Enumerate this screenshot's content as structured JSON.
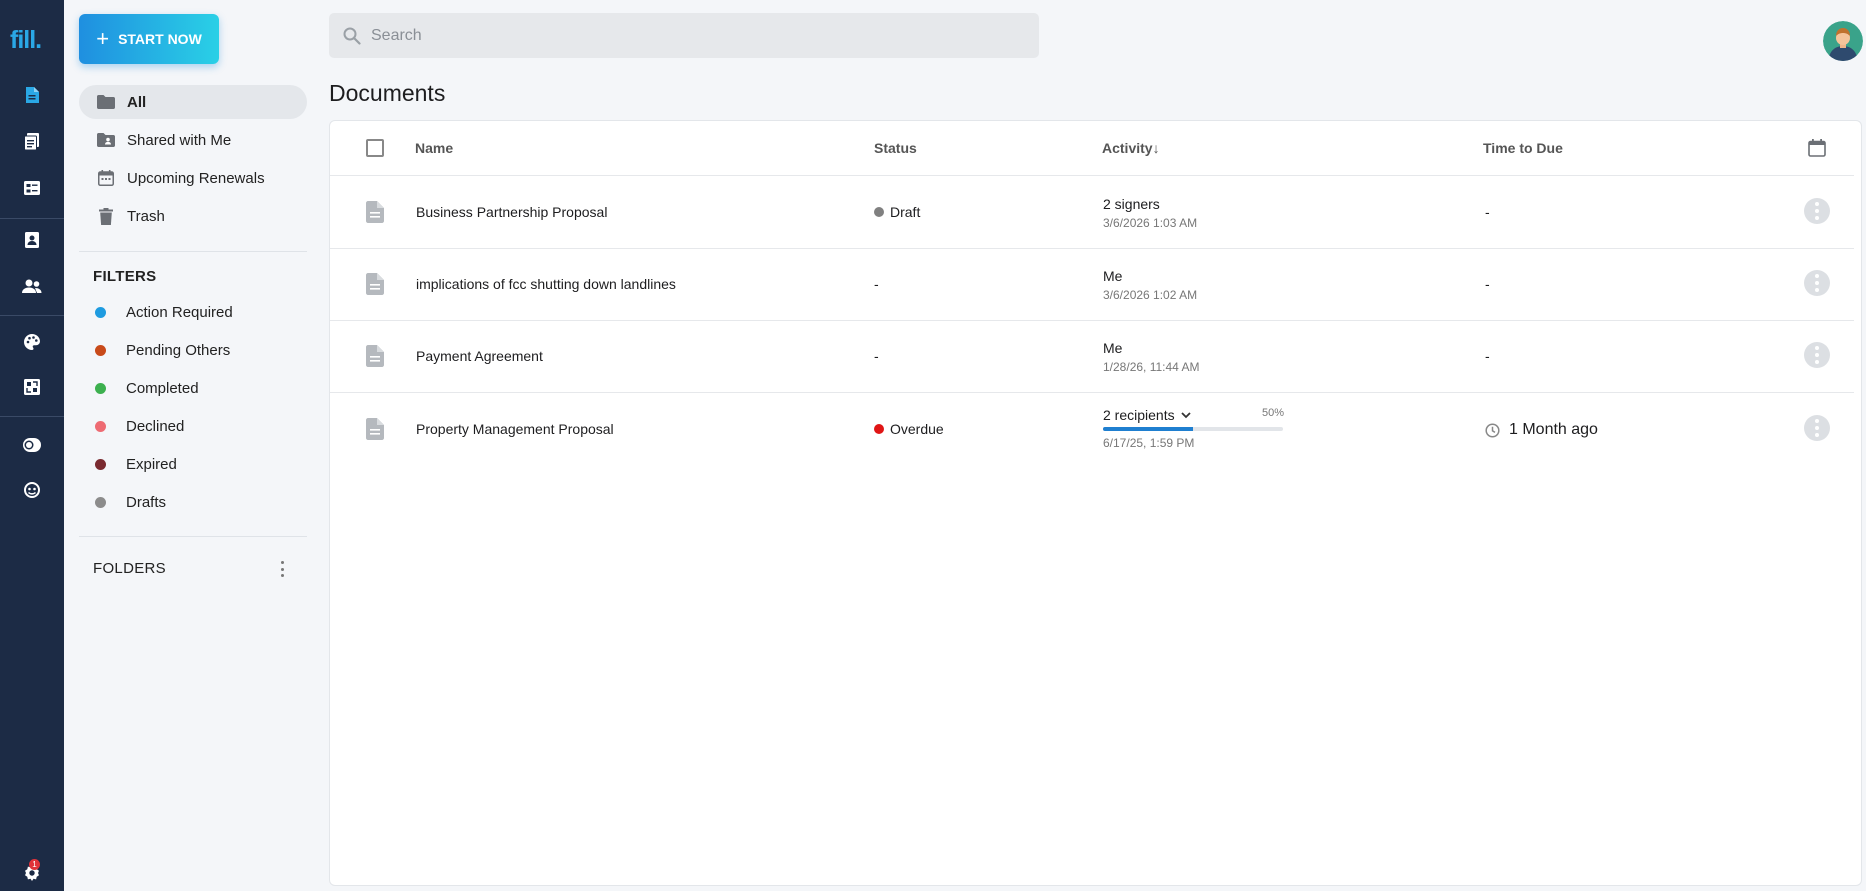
{
  "app": {
    "logo_text": "fill."
  },
  "rail": {
    "icons": [
      "documents-icon",
      "templates-icon",
      "forms-icon",
      "contacts-icon",
      "team-icon",
      "branding-icon",
      "integrations-icon",
      "theme-icon",
      "support-icon",
      "settings-icon"
    ],
    "settings_badge": "1"
  },
  "start_button": {
    "label": "START NOW"
  },
  "nav": {
    "items": [
      {
        "label": "All",
        "icon": "folder-icon"
      },
      {
        "label": "Shared with Me",
        "icon": "shared-folder-icon"
      },
      {
        "label": "Upcoming Renewals",
        "icon": "calendar-icon"
      },
      {
        "label": "Trash",
        "icon": "trash-icon"
      }
    ],
    "active_index": 0
  },
  "filters": {
    "title": "FILTERS",
    "items": [
      {
        "label": "Action Required",
        "color": "#1e9be0"
      },
      {
        "label": "Pending Others",
        "color": "#c84a1a"
      },
      {
        "label": "Completed",
        "color": "#3cb04f"
      },
      {
        "label": "Declined",
        "color": "#ee6b73"
      },
      {
        "label": "Expired",
        "color": "#7a2a30"
      },
      {
        "label": "Drafts",
        "color": "#8c8c8c"
      }
    ]
  },
  "folders": {
    "title": "FOLDERS"
  },
  "search": {
    "placeholder": "Search"
  },
  "page": {
    "title": "Documents"
  },
  "table": {
    "columns": {
      "name": "Name",
      "status": "Status",
      "activity": "Activity",
      "activity_sort": "↓",
      "time_to_due": "Time to Due"
    },
    "rows": [
      {
        "name": "Business Partnership Proposal",
        "status": "Draft",
        "status_color": "#808080",
        "activity_main": "2 signers",
        "activity_sub": "3/6/2026 1:03 AM",
        "due": "-"
      },
      {
        "name": "implications of fcc shutting down landlines",
        "status": "-",
        "activity_main": "Me",
        "activity_sub": "3/6/2026 1:02 AM",
        "due": "-"
      },
      {
        "name": "Payment Agreement",
        "status": "-",
        "activity_main": "Me",
        "activity_sub": "1/28/26, 11:44 AM",
        "due": "-"
      },
      {
        "name": "Property Management Proposal",
        "status": "Overdue",
        "status_color": "#e01515",
        "activity_main": "2 recipients",
        "activity_sub": "6/17/25, 1:59 PM",
        "progress_label": "50%",
        "progress": 0.5,
        "due": "1 Month ago"
      }
    ]
  },
  "colors": {
    "rail_bg": "#1c2b45",
    "accent": "#1f8fe0",
    "accent2": "#2ad0e6"
  }
}
